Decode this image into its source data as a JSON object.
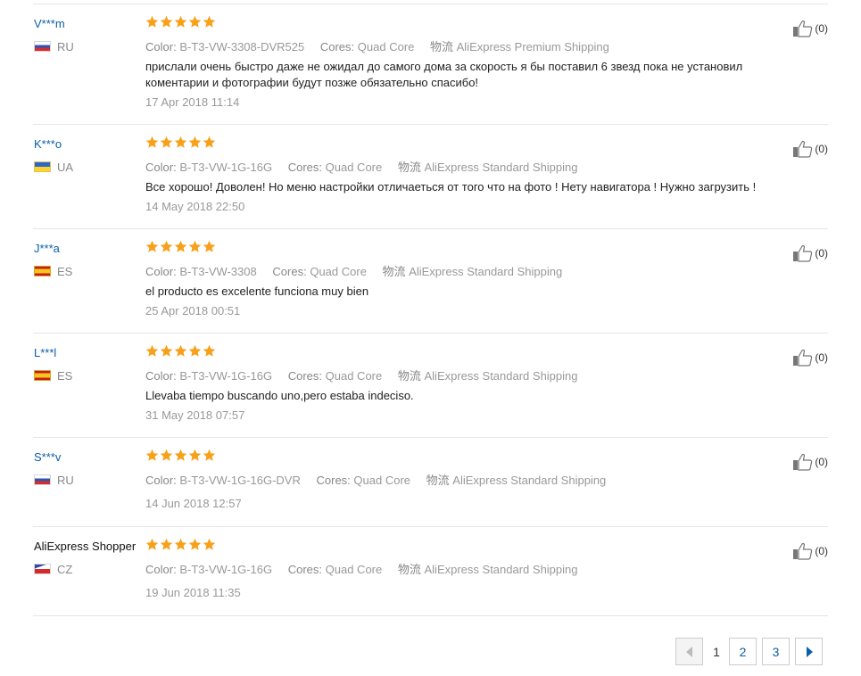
{
  "reviews": [
    {
      "user": "V***m",
      "country": "RU",
      "rating": 5,
      "meta": {
        "color_key": "Color:",
        "color_value": "B-T3-VW-3308-DVR525",
        "cores_key": "Cores:",
        "cores_value": "Quad Core",
        "ship_key": "物流",
        "ship_value": "AliExpress Premium Shipping"
      },
      "feedback": "прислали очень быстро даже не ожидал до самого дома за скорость я бы поставил 6 звезд пока не установил коментарии и фотографии будут позже обязательно спасибо!",
      "date": "17 Apr 2018 11:14",
      "helpful": "(0)"
    },
    {
      "user": "K***o",
      "country": "UA",
      "rating": 5,
      "meta": {
        "color_key": "Color:",
        "color_value": "B-T3-VW-1G-16G",
        "cores_key": "Cores:",
        "cores_value": "Quad Core",
        "ship_key": "物流",
        "ship_value": "AliExpress Standard Shipping"
      },
      "feedback": "Все хорошо! Доволен! Но меню настройки отличаеться от того что на фото ! Нету навигатора ! Нужно загрузить !",
      "date": "14 May 2018 22:50",
      "helpful": "(0)"
    },
    {
      "user": "J***a",
      "country": "ES",
      "rating": 5,
      "meta": {
        "color_key": "Color:",
        "color_value": "B-T3-VW-3308",
        "cores_key": "Cores:",
        "cores_value": "Quad Core",
        "ship_key": "物流",
        "ship_value": "AliExpress Standard Shipping"
      },
      "feedback": "el producto es excelente funciona muy bien",
      "date": "25 Apr 2018 00:51",
      "helpful": "(0)"
    },
    {
      "user": "L***l",
      "country": "ES",
      "rating": 5,
      "meta": {
        "color_key": "Color:",
        "color_value": "B-T3-VW-1G-16G",
        "cores_key": "Cores:",
        "cores_value": "Quad Core",
        "ship_key": "物流",
        "ship_value": "AliExpress Standard Shipping"
      },
      "feedback": "Llevaba tiempo buscando uno,pero estaba indeciso.",
      "date": "31 May 2018 07:57",
      "helpful": "(0)"
    },
    {
      "user": "S***v",
      "country": "RU",
      "rating": 5,
      "meta": {
        "color_key": "Color:",
        "color_value": "B-T3-VW-1G-16G-DVR",
        "cores_key": "Cores:",
        "cores_value": "Quad Core",
        "ship_key": "物流",
        "ship_value": "AliExpress Standard Shipping"
      },
      "feedback": "",
      "date": "14 Jun 2018 12:57",
      "helpful": "(0)"
    },
    {
      "user": "AliExpress Shopper",
      "country": "CZ",
      "rating": 5,
      "meta": {
        "color_key": "Color:",
        "color_value": "B-T3-VW-1G-16G",
        "cores_key": "Cores:",
        "cores_value": "Quad Core",
        "ship_key": "物流",
        "ship_value": "AliExpress Standard Shipping"
      },
      "feedback": "",
      "date": "19 Jun 2018 11:35",
      "helpful": "(0)"
    }
  ],
  "pagination": {
    "current": "1",
    "page2": "2",
    "page3": "3"
  },
  "colors": {
    "star": "#f7a11a",
    "link": "#0b5ea8",
    "muted": "#999999",
    "divider": "#e6e6e6"
  },
  "icons": {
    "rating": "star-icon",
    "helpful": "thumbs-up-icon",
    "prev": "chevron-left-icon",
    "next": "chevron-right-icon"
  }
}
